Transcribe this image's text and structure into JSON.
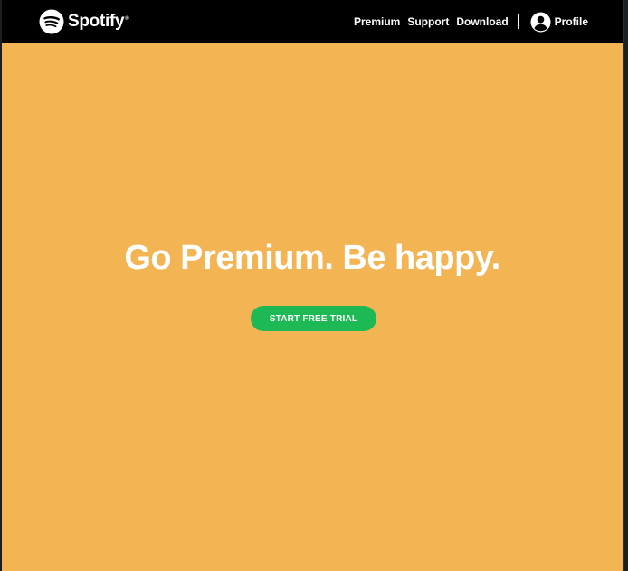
{
  "navbar": {
    "brand": "Spotify",
    "brand_mark": "®",
    "brand_icon": "spotify-logo-icon",
    "links": [
      {
        "label": "Premium"
      },
      {
        "label": "Support"
      },
      {
        "label": "Download"
      }
    ],
    "profile": {
      "label": "Profile",
      "icon": "user-circle-icon"
    }
  },
  "hero": {
    "title": "Go Premium. Be happy.",
    "cta_label": "START FREE TRIAL"
  },
  "colors": {
    "navbar_bg": "#000000",
    "hero_bg": "#f3b454",
    "cta_bg": "#1db954",
    "text": "#ffffff"
  }
}
